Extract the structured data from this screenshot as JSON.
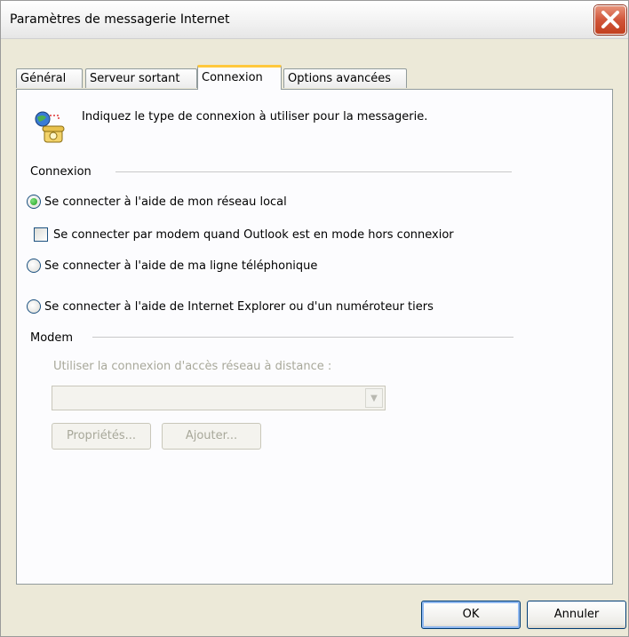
{
  "window": {
    "title": "Paramètres de messagerie Internet"
  },
  "tabs": [
    {
      "label": "Général"
    },
    {
      "label": "Serveur sortant"
    },
    {
      "label": "Connexion",
      "active": true
    },
    {
      "label": "Options avancées"
    }
  ],
  "intro": {
    "text": "Indiquez le type de connexion à utiliser pour la messagerie.",
    "icon": "network-phone-icon"
  },
  "connexion_group": {
    "label": "Connexion",
    "options": {
      "lan": {
        "label": "Se connecter à l'aide de mon réseau local",
        "checked": true
      },
      "modem_offline": {
        "label": "Se connecter par modem quand Outlook est en mode hors connexior",
        "checked": false
      },
      "phone": {
        "label": "Se connecter à l'aide de ma ligne téléphonique",
        "checked": false
      },
      "ie_dialer": {
        "label": "Se connecter à l'aide de Internet Explorer ou d'un numéroteur tiers",
        "checked": false
      }
    }
  },
  "modem_group": {
    "label": "Modem",
    "dialup_label": "Utiliser la connexion d'accès réseau à distance :",
    "dialup_value": "",
    "properties_button": "Propriétés...",
    "add_button": "Ajouter..."
  },
  "footer": {
    "ok": "OK",
    "cancel": "Annuler"
  },
  "colors": {
    "accent_tab": "#ffc83c",
    "close": "#d1553a",
    "dialog_bg": "#ece9d8"
  }
}
